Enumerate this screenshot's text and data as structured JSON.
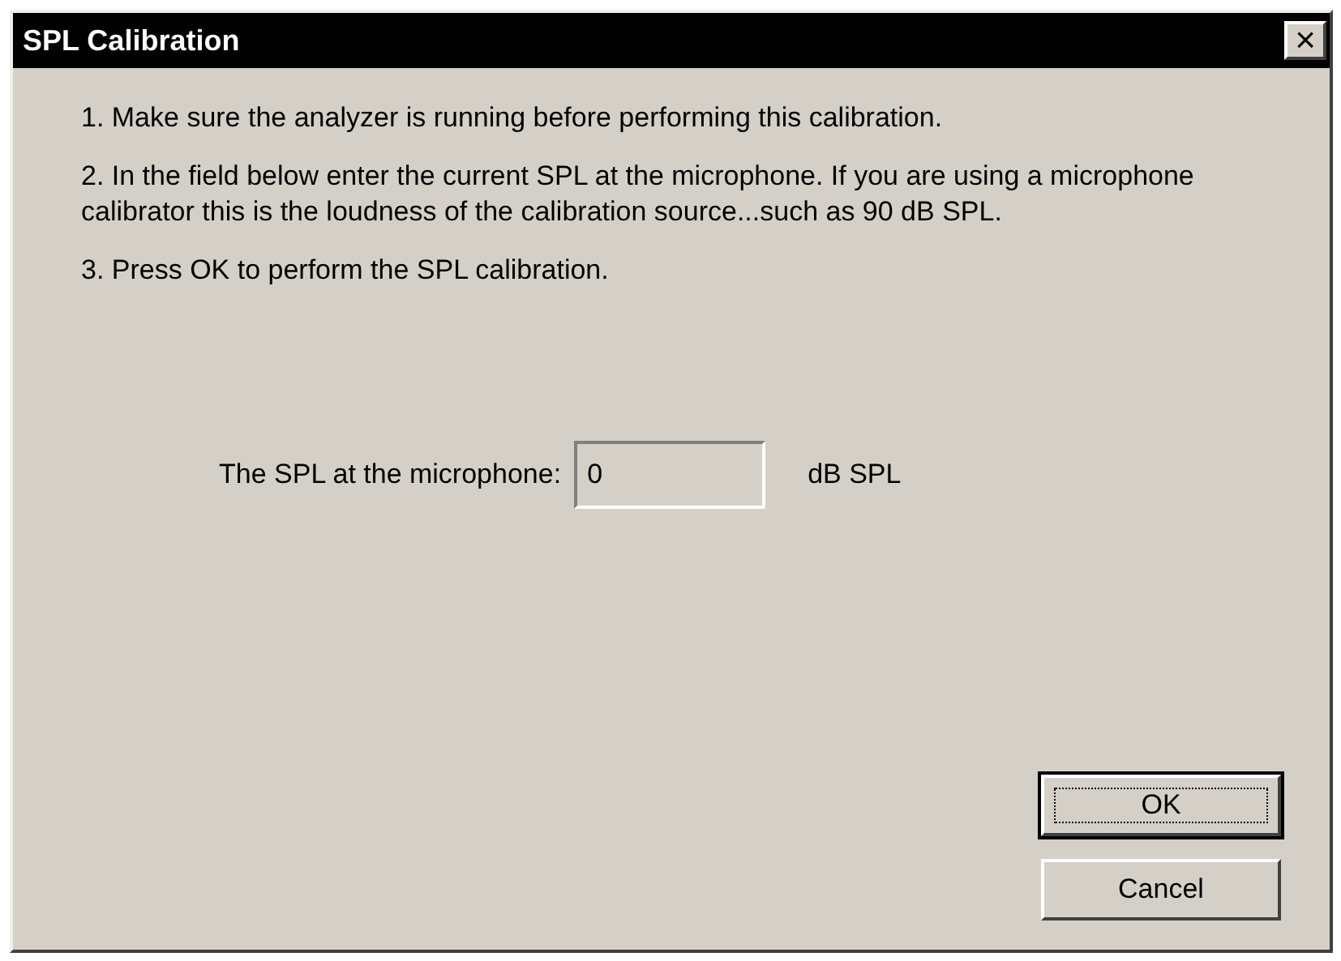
{
  "window": {
    "title": "SPL Calibration",
    "close": "×"
  },
  "instructions": [
    "1. Make sure the analyzer is running before performing this calibration.",
    "2. In the field below enter the current SPL at the microphone. If you are using a microphone calibrator this is the loudness of the calibration source...such as 90 dB SPL.",
    "3. Press OK to perform the SPL calibration."
  ],
  "spl_field": {
    "label": "The SPL at the microphone:",
    "value": "0",
    "unit": "dB SPL"
  },
  "buttons": [
    {
      "label": "OK",
      "default": true
    },
    {
      "label": "Cancel",
      "default": false
    }
  ]
}
